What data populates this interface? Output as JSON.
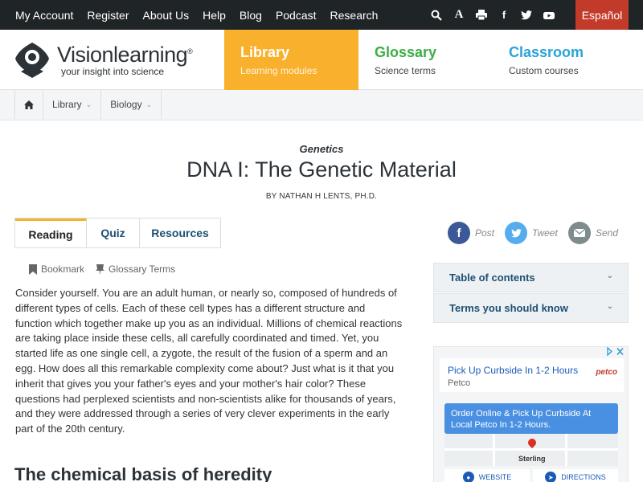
{
  "topnav": {
    "links": [
      "My Account",
      "Register",
      "About Us",
      "Help",
      "Blog",
      "Podcast",
      "Research"
    ],
    "icons": [
      "search-icon",
      "font-size-icon",
      "print-icon",
      "facebook-icon",
      "twitter-icon",
      "youtube-icon"
    ],
    "language": "Español"
  },
  "brand": {
    "name": "Visionlearning",
    "trademark": "®",
    "tagline": "your insight into science"
  },
  "mainnav": {
    "library": {
      "title": "Library",
      "subtitle": "Learning modules"
    },
    "glossary": {
      "title": "Glossary",
      "subtitle": "Science terms"
    },
    "classroom": {
      "title": "Classroom",
      "subtitle": "Custom courses"
    }
  },
  "breadcrumb": {
    "home_icon": "home-icon",
    "items": [
      "Library",
      "Biology"
    ]
  },
  "article": {
    "category": "Genetics",
    "title": "DNA I: The Genetic Material",
    "byline": "BY NATHAN H LENTS, PH.D.",
    "tabs": [
      "Reading",
      "Quiz",
      "Resources"
    ],
    "active_tab": "Reading",
    "tools": {
      "bookmark": "Bookmark",
      "glossary": "Glossary Terms"
    },
    "body": {
      "p1": "Consider yourself. You are an adult human, or nearly so, composed of hundreds of different types of ",
      "t1": "cells",
      "p2": ". Each of these cell types has a different structure and function which together make up you as an individual. Millions of ",
      "t2": "chemical reactions",
      "p3": " are taking place inside these cells, all carefully coordinated and timed. Yet, you started life as one single cell, a ",
      "t3": "zygote",
      "p4": ", the result of the fusion of a sperm and an egg. How does all this remarkable complexity come about? Just what is it that you inherit that gives you your father's eyes and your mother's hair color? These questions had perplexed scientists and non-scientists alike for thousands of years, and they were addressed through a series of very clever ",
      "t4": "experiments",
      "p5": " in the early part of the 20th century."
    },
    "section_heading": "The chemical basis of heredity"
  },
  "share": {
    "post": "Post",
    "tweet": "Tweet",
    "send": "Send"
  },
  "sidebar": {
    "toc": "Table of contents",
    "terms": "Terms you should know"
  },
  "ad": {
    "headline": "Pick Up Curbside In 1-2 Hours",
    "advertiser": "Petco",
    "logo_text": "petco",
    "offer": "Order Online & Pick Up Curbside At Local Petco In 1-2 Hours.",
    "map_city": "Sterling",
    "btn_website": "WEBSITE",
    "btn_directions": "DIRECTIONS"
  },
  "colors": {
    "topbar": "#1f2427",
    "espanol": "#c23a2a",
    "library": "#f9b02c",
    "glossary": "#3cae44",
    "classroom": "#2aa3d6",
    "link": "#1d4f73",
    "facebook": "#3b5998",
    "twitter": "#55acee",
    "email": "#7f8c8d"
  }
}
